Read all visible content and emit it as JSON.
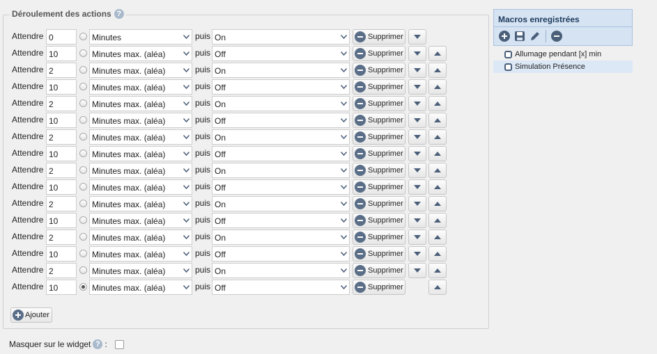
{
  "legend": {
    "title": "Déroulement des actions",
    "help": "?"
  },
  "labels": {
    "wait": "Attendre",
    "then": "puis",
    "delete": "Supprimer"
  },
  "rows": [
    {
      "value": "0",
      "unit": "Minutes",
      "state": "On",
      "radio": false,
      "up": false,
      "down": true
    },
    {
      "value": "10",
      "unit": "Minutes max. (aléa)",
      "state": "Off",
      "radio": false,
      "up": true,
      "down": true
    },
    {
      "value": "2",
      "unit": "Minutes max. (aléa)",
      "state": "On",
      "radio": false,
      "up": true,
      "down": true
    },
    {
      "value": "10",
      "unit": "Minutes max. (aléa)",
      "state": "Off",
      "radio": false,
      "up": true,
      "down": true
    },
    {
      "value": "2",
      "unit": "Minutes max. (aléa)",
      "state": "On",
      "radio": false,
      "up": true,
      "down": true
    },
    {
      "value": "10",
      "unit": "Minutes max. (aléa)",
      "state": "Off",
      "radio": false,
      "up": true,
      "down": true
    },
    {
      "value": "2",
      "unit": "Minutes max. (aléa)",
      "state": "On",
      "radio": false,
      "up": true,
      "down": true
    },
    {
      "value": "10",
      "unit": "Minutes max. (aléa)",
      "state": "Off",
      "radio": false,
      "up": true,
      "down": true
    },
    {
      "value": "2",
      "unit": "Minutes max. (aléa)",
      "state": "On",
      "radio": false,
      "up": true,
      "down": true
    },
    {
      "value": "10",
      "unit": "Minutes max. (aléa)",
      "state": "Off",
      "radio": false,
      "up": true,
      "down": true
    },
    {
      "value": "2",
      "unit": "Minutes max. (aléa)",
      "state": "On",
      "radio": false,
      "up": true,
      "down": true
    },
    {
      "value": "10",
      "unit": "Minutes max. (aléa)",
      "state": "Off",
      "radio": false,
      "up": true,
      "down": true
    },
    {
      "value": "2",
      "unit": "Minutes max. (aléa)",
      "state": "On",
      "radio": false,
      "up": true,
      "down": true
    },
    {
      "value": "10",
      "unit": "Minutes max. (aléa)",
      "state": "Off",
      "radio": false,
      "up": true,
      "down": true
    },
    {
      "value": "2",
      "unit": "Minutes max. (aléa)",
      "state": "On",
      "radio": false,
      "up": true,
      "down": true
    },
    {
      "value": "10",
      "unit": "Minutes max. (aléa)",
      "state": "Off",
      "radio": true,
      "up": true,
      "down": false
    }
  ],
  "add_button": "Ajouter",
  "footer": {
    "label": "Masquer sur le widget",
    "help": "?",
    "colon": ":"
  },
  "macros": {
    "title": "Macros enregistrées",
    "toolbar": [
      "add-icon",
      "save-icon",
      "edit-icon",
      "remove-icon"
    ],
    "items": [
      {
        "label": "Allumage pendant [x] min",
        "selected": false
      },
      {
        "label": "Simulation Présence",
        "selected": true
      }
    ]
  },
  "colors": {
    "accent": "#5a6e88",
    "panel": "#d5e3f3",
    "panel_border": "#a9c1dd",
    "selected": "#dde8f7"
  }
}
